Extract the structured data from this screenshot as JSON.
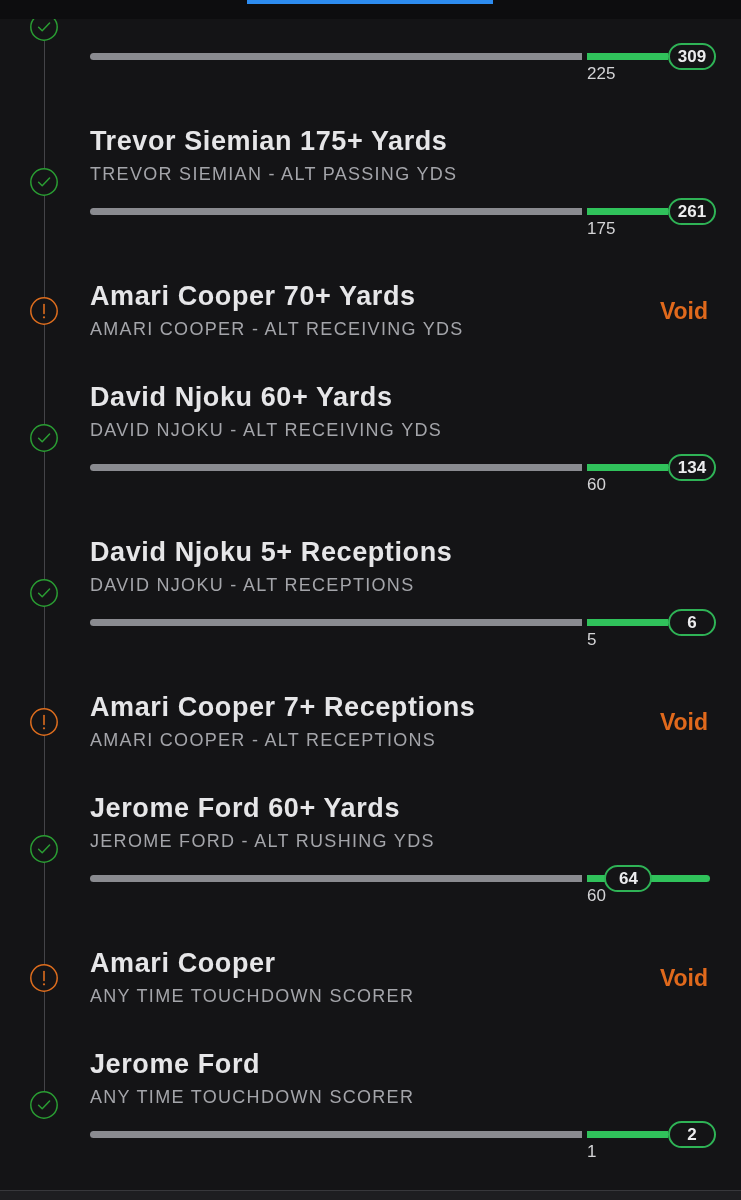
{
  "items": [
    {
      "kind": "progress",
      "void": false,
      "threshold": "225",
      "value": "309",
      "level": 1
    },
    {
      "kind": "progress",
      "void": false,
      "title": "Trevor Siemian 175+ Yards",
      "subtitle": "TREVOR SIEMIAN - ALT PASSING YDS",
      "threshold": "175",
      "value": "261",
      "level": 1
    },
    {
      "kind": "result",
      "void": true,
      "title": "Amari Cooper 70+ Yards",
      "subtitle": "AMARI COOPER - ALT RECEIVING YDS",
      "result": "Void"
    },
    {
      "kind": "progress",
      "void": false,
      "title": "David Njoku 60+ Yards",
      "subtitle": "DAVID NJOKU - ALT RECEIVING YDS",
      "threshold": "60",
      "value": "134",
      "level": 1
    },
    {
      "kind": "progress",
      "void": false,
      "title": "David Njoku 5+ Receptions",
      "subtitle": "DAVID NJOKU - ALT RECEPTIONS",
      "threshold": "5",
      "value": "6",
      "level": 1
    },
    {
      "kind": "result",
      "void": true,
      "title": "Amari Cooper 7+ Receptions",
      "subtitle": "AMARI COOPER - ALT RECEPTIONS",
      "result": "Void"
    },
    {
      "kind": "progress",
      "void": false,
      "title": "Jerome Ford 60+ Yards",
      "subtitle": "JEROME FORD - ALT RUSHING YDS",
      "threshold": "60",
      "value": "64",
      "level": 0.89
    },
    {
      "kind": "result",
      "void": true,
      "title": "Amari Cooper",
      "subtitle": "ANY TIME TOUCHDOWN SCORER",
      "result": "Void"
    },
    {
      "kind": "progress",
      "void": false,
      "title": "Jerome Ford",
      "subtitle": "ANY TIME TOUCHDOWN SCORER",
      "threshold": "1",
      "value": "2",
      "level": 1
    }
  ]
}
